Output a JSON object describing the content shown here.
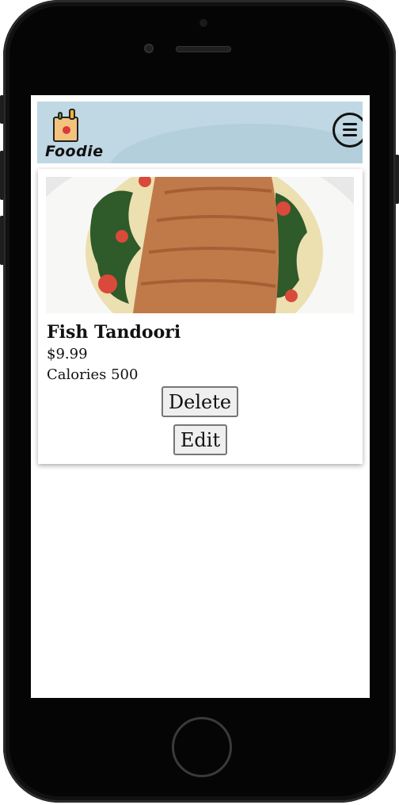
{
  "app": {
    "logo_text": "Foodie",
    "colors": {
      "header_bg": "#bfd8e3",
      "button_bg": "#efefef",
      "text": "#111111"
    }
  },
  "header": {
    "menu_icon": "hamburger-menu-icon"
  },
  "card": {
    "image_alt": "salmon-fillet-on-spinach-and-tomatoes",
    "name": "Fish Tandoori",
    "price": "$9.99",
    "calories": "Calories 500",
    "delete_label": "Delete",
    "edit_label": "Edit"
  }
}
